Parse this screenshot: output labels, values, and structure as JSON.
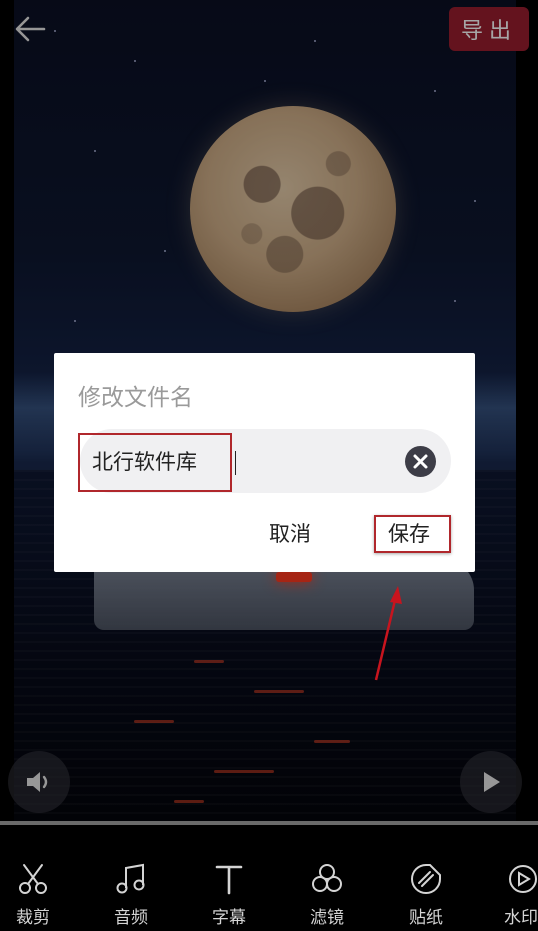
{
  "header": {
    "export_label": "导出"
  },
  "player": {
    "progress": 0.0
  },
  "dialog": {
    "title": "修改文件名",
    "filename_value": "北行软件库",
    "cancel_label": "取消",
    "save_label": "保存"
  },
  "toolbar": {
    "items": [
      {
        "label": "裁剪",
        "icon": "scissors-icon"
      },
      {
        "label": "音频",
        "icon": "music-note-icon"
      },
      {
        "label": "字幕",
        "icon": "text-icon"
      },
      {
        "label": "滤镜",
        "icon": "filter-circles-icon"
      },
      {
        "label": "贴纸",
        "icon": "sticker-icon"
      },
      {
        "label": "水印",
        "icon": "watermark-icon"
      }
    ]
  },
  "colors": {
    "accent": "#9a1e2f",
    "annotation": "#b0272c"
  }
}
